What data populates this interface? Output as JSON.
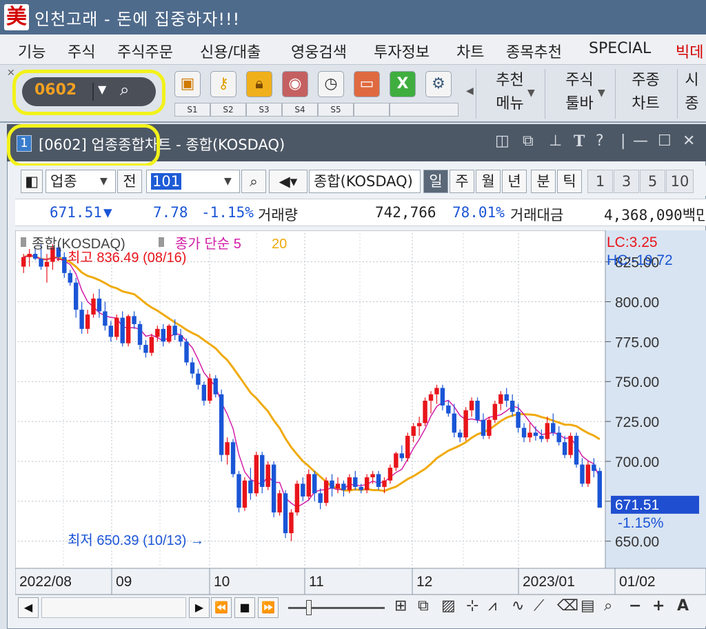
{
  "app": {
    "title": "인천고래 - 돈에 집중하자!!!",
    "logo_text": "美"
  },
  "menu": {
    "items": [
      "기능",
      "주식",
      "주식주문",
      "신용/대출",
      "영웅검색",
      "투자정보",
      "차트",
      "종목추천",
      "SPECIAL",
      "빅데"
    ]
  },
  "toolbar": {
    "screen_code": "0602",
    "slots": [
      "S1",
      "S2",
      "S3",
      "S4",
      "S5",
      "",
      ""
    ],
    "icons": [
      "save-icon",
      "key-icon",
      "lock-icon",
      "camera-icon",
      "clock-icon",
      "monitor-icon",
      "excel-icon",
      "gear-icon"
    ],
    "right_buttons": [
      {
        "line1": "추천",
        "line2": "메뉴"
      },
      {
        "line1": "주식",
        "line2": "툴바"
      },
      {
        "line1": "주종",
        "line2": "차트"
      },
      {
        "line1": "시",
        "line2": "종"
      }
    ]
  },
  "window": {
    "number": "1",
    "title": "[0602] 업종종합차트 - 종합(KOSDAQ)"
  },
  "controls": {
    "category": "업종",
    "prev_label": "전",
    "code_value": "101",
    "index_name": "종합(KOSDAQ)",
    "periods": [
      "일",
      "주",
      "월",
      "년",
      "분",
      "틱"
    ],
    "selected_period": "일",
    "numbers": [
      "1",
      "3",
      "5",
      "10"
    ]
  },
  "quote": {
    "price": "671.51",
    "direction": "▼",
    "change": "7.78",
    "change_pct": "-1.15%",
    "volume_label": "거래량",
    "volume": "742,766",
    "volume_ratio": "78.01%",
    "amount_label": "거래대금",
    "amount": "4,368,090백만"
  },
  "chart_data": {
    "type": "candlestick",
    "legend": {
      "name": "종합(KOSDAQ)",
      "ma_label": "종가 단순",
      "ma5": "5",
      "ma20": "20"
    },
    "lc": "LC:3.25",
    "hc": "HC:-19.72",
    "high_annotation": "최고 836.49 (08/16)",
    "low_annotation": "최저 650.39 (10/13)",
    "current_price": "671.51",
    "current_pct": "-1.15%",
    "y_ticks": [
      "825.00",
      "800.00",
      "775.00",
      "750.00",
      "725.00",
      "700.00",
      "675.00",
      "650.00"
    ],
    "y_range": [
      633,
      843
    ],
    "x_labels": [
      "2022/08",
      "09",
      "10",
      "11",
      "12",
      "2023/01",
      "01/02"
    ],
    "colors": {
      "up": "#e8151b",
      "down": "#1a55d6",
      "ma5": "#d21ea8",
      "ma20": "#f0aa0a",
      "price_tag": "#1f4ed0"
    },
    "candles": [
      [
        822,
        830,
        818,
        828
      ],
      [
        828,
        833,
        822,
        830
      ],
      [
        830,
        834,
        826,
        827
      ],
      [
        827,
        836,
        820,
        822
      ],
      [
        822,
        830,
        812,
        825
      ],
      [
        825,
        836,
        820,
        834
      ],
      [
        834,
        836,
        826,
        828
      ],
      [
        828,
        831,
        815,
        818
      ],
      [
        818,
        820,
        810,
        812
      ],
      [
        812,
        815,
        790,
        795
      ],
      [
        795,
        800,
        780,
        783
      ],
      [
        783,
        795,
        780,
        792
      ],
      [
        792,
        805,
        790,
        802
      ],
      [
        802,
        808,
        790,
        794
      ],
      [
        794,
        800,
        782,
        785
      ],
      [
        785,
        788,
        775,
        778
      ],
      [
        778,
        792,
        776,
        790
      ],
      [
        790,
        794,
        772,
        774
      ],
      [
        774,
        792,
        772,
        791
      ],
      [
        791,
        794,
        783,
        786
      ],
      [
        786,
        788,
        770,
        773
      ],
      [
        773,
        776,
        765,
        768
      ],
      [
        768,
        780,
        766,
        778
      ],
      [
        778,
        785,
        775,
        783
      ],
      [
        783,
        786,
        772,
        775
      ],
      [
        775,
        786,
        774,
        785
      ],
      [
        785,
        789,
        776,
        779
      ],
      [
        779,
        783,
        772,
        775
      ],
      [
        775,
        777,
        760,
        762
      ],
      [
        762,
        765,
        752,
        755
      ],
      [
        755,
        758,
        745,
        748
      ],
      [
        748,
        750,
        735,
        738
      ],
      [
        738,
        755,
        736,
        752
      ],
      [
        752,
        754,
        740,
        742
      ],
      [
        742,
        745,
        700,
        704
      ],
      [
        704,
        715,
        698,
        712
      ],
      [
        712,
        714,
        690,
        692
      ],
      [
        692,
        694,
        668,
        671
      ],
      [
        671,
        690,
        669,
        688
      ],
      [
        688,
        696,
        676,
        680
      ],
      [
        680,
        706,
        678,
        704
      ],
      [
        704,
        706,
        680,
        684
      ],
      [
        684,
        700,
        682,
        698
      ],
      [
        698,
        700,
        665,
        668
      ],
      [
        668,
        682,
        666,
        680
      ],
      [
        680,
        682,
        652,
        655
      ],
      [
        655,
        670,
        650,
        668
      ],
      [
        668,
        688,
        666,
        686
      ],
      [
        686,
        690,
        675,
        678
      ],
      [
        678,
        695,
        676,
        692
      ],
      [
        692,
        694,
        675,
        680
      ],
      [
        680,
        683,
        670,
        674
      ],
      [
        674,
        690,
        672,
        688
      ],
      [
        688,
        692,
        678,
        683
      ],
      [
        683,
        690,
        680,
        686
      ],
      [
        686,
        688,
        678,
        682
      ],
      [
        682,
        692,
        680,
        690
      ],
      [
        690,
        694,
        682,
        684
      ],
      [
        684,
        686,
        680,
        682
      ],
      [
        682,
        692,
        680,
        690
      ],
      [
        690,
        694,
        686,
        692
      ],
      [
        692,
        694,
        682,
        684
      ],
      [
        684,
        690,
        680,
        688
      ],
      [
        688,
        698,
        686,
        696
      ],
      [
        696,
        706,
        694,
        705
      ],
      [
        705,
        710,
        700,
        702
      ],
      [
        702,
        718,
        700,
        716
      ],
      [
        716,
        724,
        712,
        722
      ],
      [
        722,
        728,
        716,
        724
      ],
      [
        724,
        740,
        722,
        738
      ],
      [
        738,
        744,
        730,
        742
      ],
      [
        742,
        748,
        736,
        746
      ],
      [
        746,
        748,
        732,
        735
      ],
      [
        735,
        738,
        728,
        730
      ],
      [
        730,
        736,
        715,
        718
      ],
      [
        718,
        720,
        712,
        715
      ],
      [
        715,
        734,
        713,
        732
      ],
      [
        732,
        740,
        728,
        738
      ],
      [
        738,
        740,
        724,
        726
      ],
      [
        726,
        730,
        714,
        716
      ],
      [
        716,
        728,
        714,
        726
      ],
      [
        726,
        738,
        724,
        736
      ],
      [
        736,
        744,
        732,
        742
      ],
      [
        742,
        746,
        734,
        738
      ],
      [
        738,
        742,
        728,
        731
      ],
      [
        731,
        736,
        718,
        721
      ],
      [
        721,
        724,
        712,
        715
      ],
      [
        715,
        724,
        712,
        718
      ],
      [
        718,
        722,
        713,
        716
      ],
      [
        716,
        720,
        712,
        714
      ],
      [
        714,
        728,
        712,
        724
      ],
      [
        724,
        730,
        716,
        718
      ],
      [
        718,
        722,
        710,
        712
      ],
      [
        712,
        716,
        702,
        704
      ],
      [
        704,
        718,
        702,
        716
      ],
      [
        716,
        718,
        696,
        698
      ],
      [
        698,
        702,
        684,
        686
      ],
      [
        686,
        700,
        684,
        698
      ],
      [
        698,
        702,
        690,
        694
      ],
      [
        694,
        696,
        672,
        671
      ]
    ]
  },
  "bottom": {
    "buttons": [
      "◀",
      "▶",
      "⏪",
      "■",
      "⏩"
    ],
    "icons": [
      "zoom-in-icon",
      "zoom-out-icon",
      "plus-icon",
      "text-icon"
    ]
  }
}
